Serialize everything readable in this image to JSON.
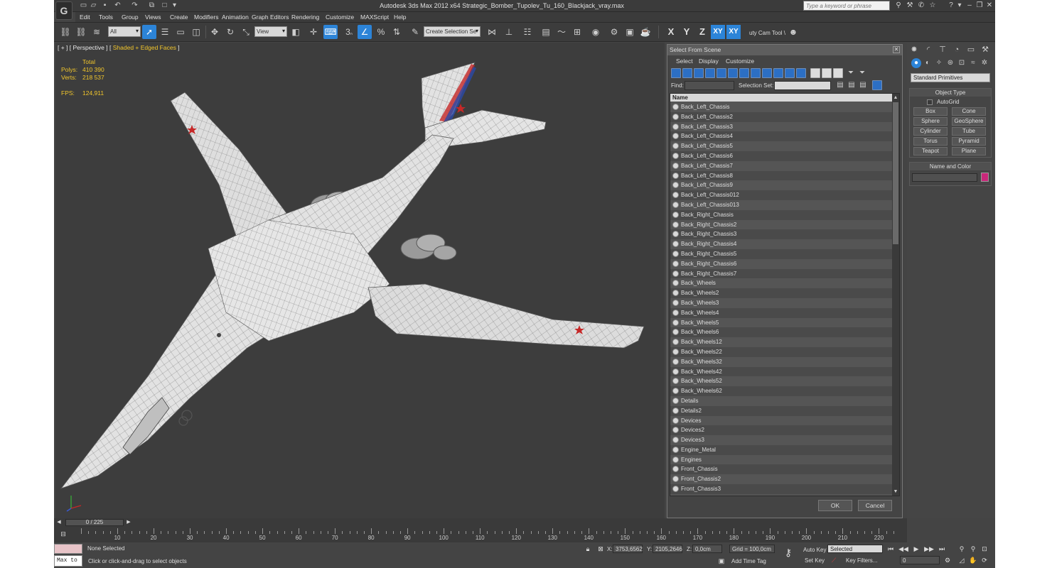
{
  "window": {
    "title": "Autodesk 3ds Max  2012 x64     Strategic_Bomber_Tupolev_Tu_160_Blackjack_vray.max",
    "search_placeholder": "Type a keyword or phrase"
  },
  "menu": [
    "Edit",
    "Tools",
    "Group",
    "Views",
    "Create",
    "Modifiers",
    "Animation",
    "Graph Editors",
    "Rendering",
    "Customize",
    "MAXScript",
    "Help"
  ],
  "toolbar": {
    "filter": "All",
    "ref_coord": "View",
    "snap_num": "3",
    "selection_set": "Create Selection Se",
    "axes": [
      "X",
      "Y",
      "Z",
      "XY",
      "XY"
    ],
    "cam_tool": "uty Cam Tool \\"
  },
  "viewport": {
    "label_prefix": "[ + ] [ Perspective ] [",
    "label_mode": "Shaded + Edged Faces",
    "label_suffix": "]",
    "stats": {
      "header": "Total",
      "polys_label": "Polys:",
      "polys": "410 390",
      "verts_label": "Verts:",
      "verts": "218 537",
      "fps_label": "FPS:",
      "fps": "124,911"
    }
  },
  "select_dialog": {
    "title": "Select From Scene",
    "menu": [
      "Select",
      "Display",
      "Customize"
    ],
    "find_label": "Find:",
    "selection_set_label": "Selection Set:",
    "column": "Name",
    "items": [
      "Back_Left_Chassis",
      "Back_Left_Chassis2",
      "Back_Left_Chassis3",
      "Back_Left_Chassis4",
      "Back_Left_Chassis5",
      "Back_Left_Chassis6",
      "Back_Left_Chassis7",
      "Back_Left_Chassis8",
      "Back_Left_Chassis9",
      "Back_Left_Chassis012",
      "Back_Left_Chassis013",
      "Back_Right_Chassis",
      "Back_Right_Chassis2",
      "Back_Right_Chassis3",
      "Back_Right_Chassis4",
      "Back_Right_Chassis5",
      "Back_Right_Chassis6",
      "Back_Right_Chassis7",
      "Back_Wheels",
      "Back_Wheels2",
      "Back_Wheels3",
      "Back_Wheels4",
      "Back_Wheels5",
      "Back_Wheels6",
      "Back_Wheels12",
      "Back_Wheels22",
      "Back_Wheels32",
      "Back_Wheels42",
      "Back_Wheels52",
      "Back_Wheels62",
      "Details",
      "Details2",
      "Devices",
      "Devices2",
      "Devices3",
      "Engine_Metal",
      "Engines",
      "Front_Chassis",
      "Front_Chassis2",
      "Front_Chassis3"
    ],
    "ok": "OK",
    "cancel": "Cancel"
  },
  "command_panel": {
    "category": "Standard Primitives",
    "object_type_title": "Object Type",
    "autogrid": "AutoGrid",
    "buttons": [
      "Box",
      "Cone",
      "Sphere",
      "GeoSphere",
      "Cylinder",
      "Tube",
      "Torus",
      "Pyramid",
      "Teapot",
      "Plane"
    ],
    "name_color_title": "Name and Color",
    "object_color": "#c8287a"
  },
  "timeline": {
    "slider": "0 / 225",
    "ticks": [
      10,
      20,
      30,
      40,
      50,
      60,
      70,
      80,
      90,
      100,
      110,
      120,
      130,
      140,
      150,
      160,
      170,
      180,
      190,
      200,
      210,
      220
    ]
  },
  "status": {
    "maxscript": "Max to",
    "selection": "None Selected",
    "prompt": "Click or click-and-drag to select objects",
    "x_label": "X:",
    "x": "3753,6562",
    "y_label": "Y:",
    "y": "2105,2646",
    "z_label": "Z:",
    "z": "0,0cm",
    "grid": "Grid = 100,0cm",
    "add_time_tag": "Add Time Tag",
    "auto_key": "Auto Key",
    "set_key": "Set Key",
    "key_mode": "Selected",
    "key_filters": "Key Filters...",
    "frame": "0"
  },
  "colors": {
    "accent": "#2c84d8",
    "stats_text": "#f2c62b",
    "viewport_bg": "#3d3d3d"
  }
}
